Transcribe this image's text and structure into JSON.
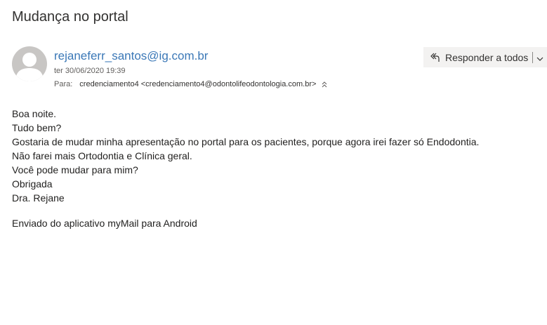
{
  "subject": "Mudança no portal",
  "message": {
    "sender": "rejaneferr_santos@ig.com.br",
    "date": "ter 30/06/2020 19:39",
    "to_label": "Para:",
    "to_value": "credenciamento4 <credenciamento4@odontolifeodontologia.com.br>",
    "actions": {
      "reply_all_label": "Responder a todos",
      "reply_icon": "reply-all-icon",
      "more_icon": "chevron-down-icon"
    },
    "body_lines": [
      "Boa noite.",
      "Tudo bem?",
      "Gostaria de mudar minha apresentação no portal para os pacientes, porque agora irei fazer só Endodontia.",
      "Não farei mais Ortodontia e Clínica geral.",
      "Você pode mudar para mim?",
      "Obrigada",
      "Dra. Rejane"
    ],
    "signature": "Enviado do aplicativo myMail para Android"
  },
  "colors": {
    "link": "#3b78b7",
    "text": "#201f1e",
    "muted": "#605e5c",
    "button_bg": "#f3f2f1",
    "avatar_bg": "#c8c6c4"
  }
}
